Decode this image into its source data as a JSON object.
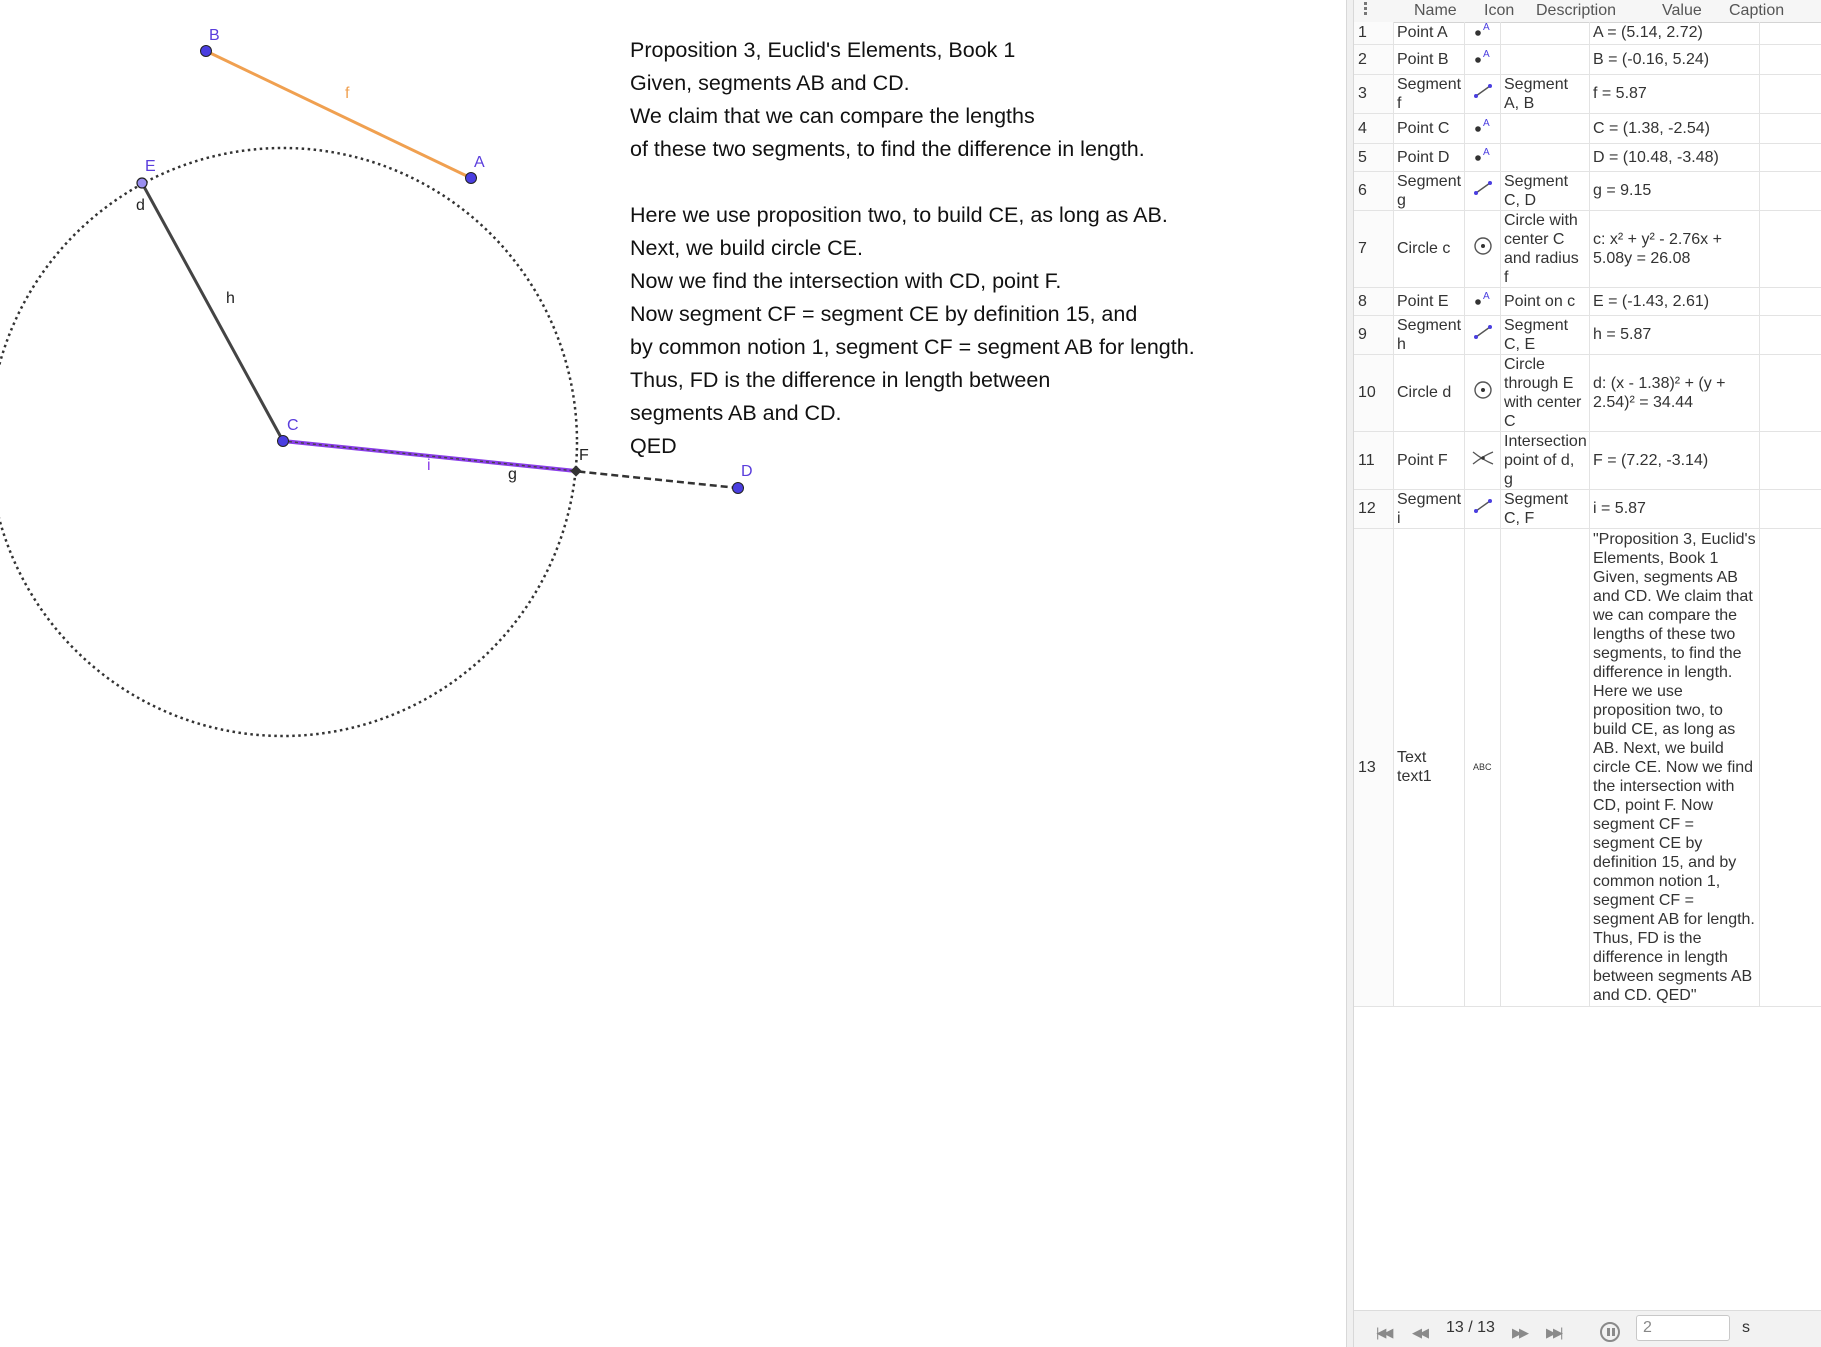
{
  "proof_text": [
    "Proposition 3, Euclid's Elements, Book 1",
    "Given, segments AB and CD.",
    "We claim that we can compare the lengths",
    "of these two segments, to find the difference in length.",
    "",
    "Here we use proposition two, to build CE, as long as AB.",
    "Next, we build circle CE.",
    "Now we find the intersection with CD, point F.",
    "Now segment CF = segment CE by definition 15, and",
    "by common notion 1, segment CF = segment AB for length.",
    "Thus, FD is the difference in length between",
    "segments AB and CD.",
    "QED"
  ],
  "canvas_labels": {
    "A": "A",
    "B": "B",
    "C": "C",
    "D": "D",
    "E": "E",
    "F": "F",
    "f": "f",
    "g": "g",
    "h": "h",
    "i": "i",
    "d": "d"
  },
  "colors": {
    "point": "#4a3ee0",
    "segment_f": "#f0a050",
    "segment_i": "#8a3ee8",
    "dark": "#333333"
  },
  "construction_header": {
    "name": "Name",
    "icon": "Icon",
    "description": "Description",
    "value": "Value",
    "caption": "Caption"
  },
  "construction_rows": [
    {
      "num": "1",
      "name": "Point A",
      "icon": "point-icon",
      "desc": "",
      "value": "A = (5.14, 2.72)"
    },
    {
      "num": "2",
      "name": "Point B",
      "icon": "point-icon",
      "desc": "",
      "value": "B = (-0.16, 5.24)"
    },
    {
      "num": "3",
      "name": "Segment f",
      "icon": "segment-icon",
      "desc": "Segment A, B",
      "value": "f = 5.87"
    },
    {
      "num": "4",
      "name": "Point C",
      "icon": "point-icon",
      "desc": "",
      "value": "C = (1.38, -2.54)"
    },
    {
      "num": "5",
      "name": "Point D",
      "icon": "point-icon",
      "desc": "",
      "value": "D = (10.48, -3.48)"
    },
    {
      "num": "6",
      "name": "Segment g",
      "icon": "segment-icon",
      "desc": "Segment C, D",
      "value": "g = 9.15"
    },
    {
      "num": "7",
      "name": "Circle c",
      "icon": "circle-icon",
      "desc": "Circle with center C and radius f",
      "value": "c: x² + y² - 2.76x + 5.08y = 26.08"
    },
    {
      "num": "8",
      "name": "Point E",
      "icon": "point-icon",
      "desc": "Point on c",
      "value": "E = (-1.43, 2.61)"
    },
    {
      "num": "9",
      "name": "Segment h",
      "icon": "segment-icon",
      "desc": "Segment C, E",
      "value": "h = 5.87"
    },
    {
      "num": "10",
      "name": "Circle d",
      "icon": "circle-icon",
      "desc": "Circle through E with center C",
      "value": "d: (x - 1.38)² + (y + 2.54)² = 34.44"
    },
    {
      "num": "11",
      "name": "Point F",
      "icon": "intersect-icon",
      "desc": "Intersection point of d, g",
      "value": "F = (7.22, -3.14)"
    },
    {
      "num": "12",
      "name": "Segment i",
      "icon": "segment-icon",
      "desc": "Segment C, F",
      "value": "i = 5.87"
    },
    {
      "num": "13",
      "name": "Text text1",
      "icon": "text-icon",
      "desc": "",
      "value": "\"Proposition 3, Euclid's Elements, Book 1 Given, segments AB and CD. We claim that we can compare the lengths of these two segments, to find the difference in length. Here we use proposition two, to build CE, as long as AB. Next, we build circle CE. Now we find the intersection with CD, point F. Now segment CF = segment CE by definition 15, and by common notion 1, segment CF = segment AB for length. Thus, FD is the difference in length between segments AB and CD. QED\""
    }
  ],
  "player": {
    "step": "13 / 13",
    "speed_value": "2",
    "speed_unit": "s"
  }
}
